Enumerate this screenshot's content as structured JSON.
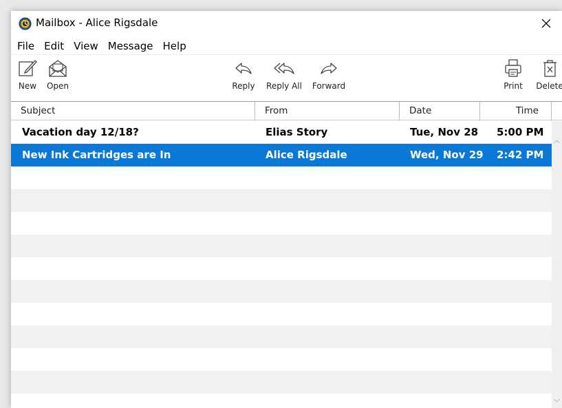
{
  "window": {
    "title": "Mailbox - Alice Rigsdale",
    "close_glyph": "✕"
  },
  "menu": [
    "File",
    "Edit",
    "View",
    "Message",
    "Help"
  ],
  "toolbar": {
    "new": "New",
    "open": "Open",
    "reply": "Reply",
    "reply_all": "Reply All",
    "forward": "Forward",
    "print": "Print",
    "delete": "Delete"
  },
  "columns": {
    "subject": "Subject",
    "from": "From",
    "date": "Date",
    "time": "Time"
  },
  "messages": [
    {
      "subject": "Vacation day 12/18?",
      "from": "Elias Story",
      "date": "Tue, Nov 28",
      "time": "5:00 PM"
    },
    {
      "subject": "New Ink Cartridges are In",
      "from": "Alice Rigsdale",
      "date": "Wed, Nov 29",
      "time": "2:42 PM"
    }
  ],
  "selected_message": 1,
  "colors": {
    "selection": "#0a78d7",
    "alt_row": "#f2f2f2"
  },
  "icons": {
    "app": "mailbox-app-icon",
    "new": "compose-icon",
    "open": "open-envelope-icon",
    "reply": "reply-arrow-icon",
    "reply_all": "reply-all-arrow-icon",
    "forward": "forward-arrow-icon",
    "print": "printer-icon",
    "delete": "delete-box-icon"
  }
}
